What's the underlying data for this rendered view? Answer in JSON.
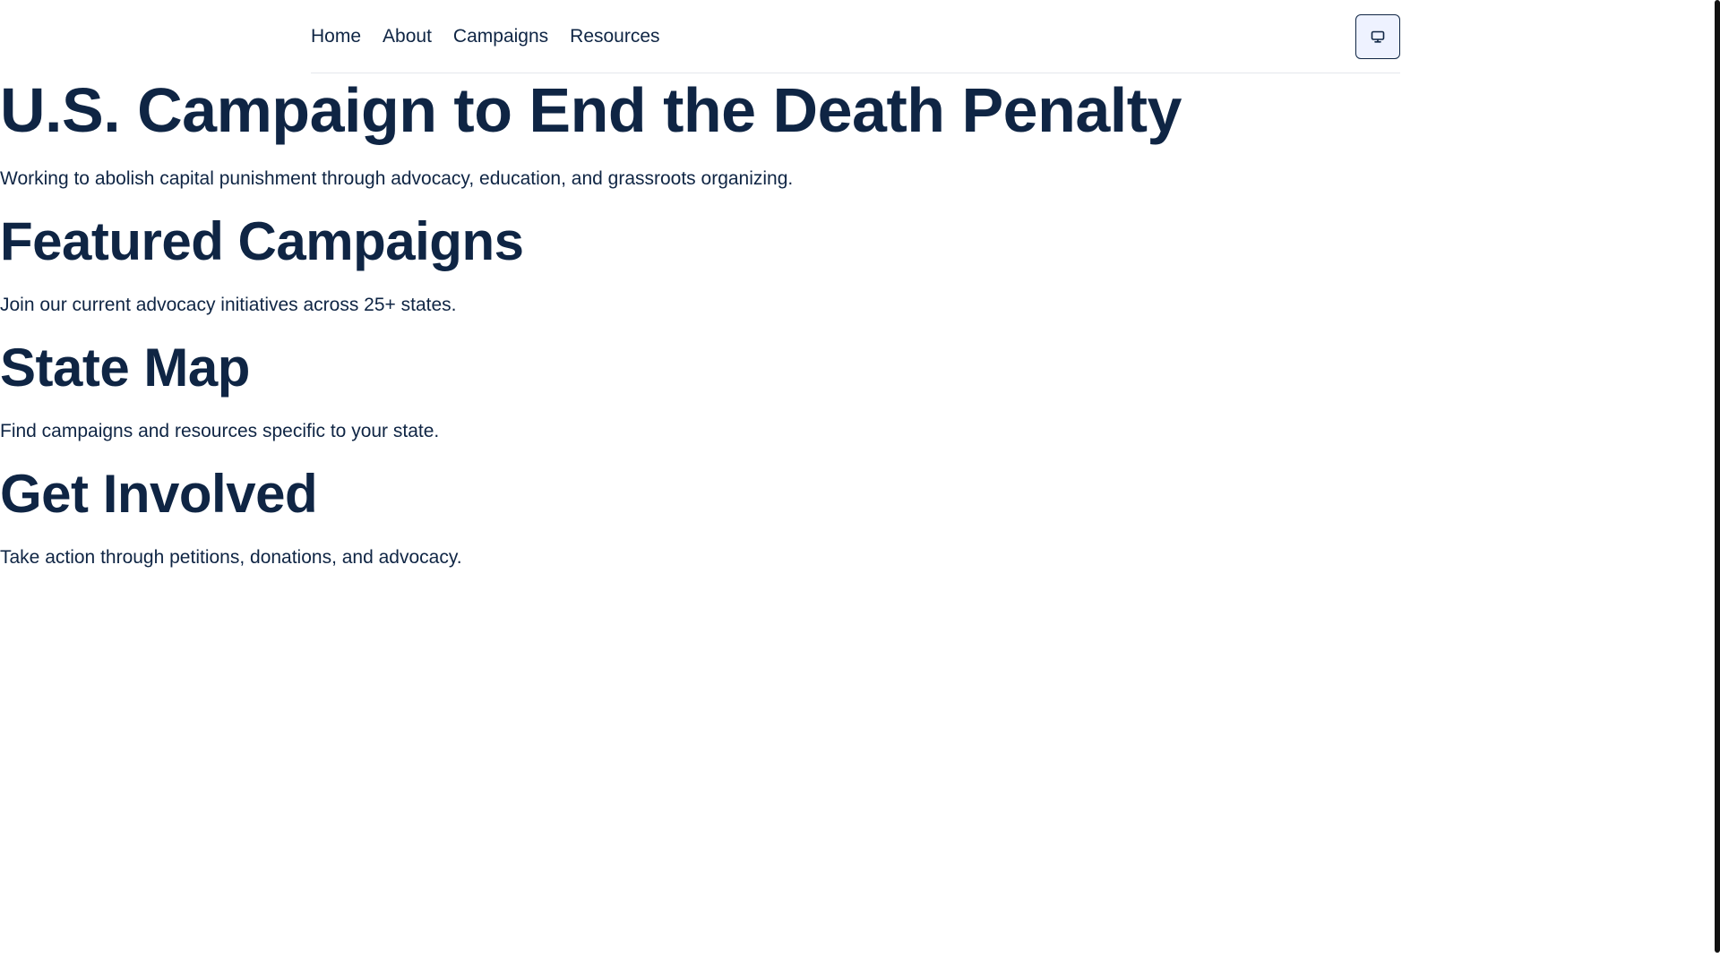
{
  "nav": {
    "links": [
      "Home",
      "About",
      "Campaigns",
      "Resources"
    ],
    "theme_toggle_icon": "monitor-icon"
  },
  "sections": [
    {
      "title": "U.S. Campaign to End the Death Penalty",
      "description": "Working to abolish capital punishment through advocacy, education, and grassroots organizing."
    },
    {
      "title": "Featured Campaigns",
      "description": "Join our current advocacy initiatives across 25+ states."
    },
    {
      "title": "State Map",
      "description": "Find campaigns and resources specific to your state."
    },
    {
      "title": "Get Involved",
      "description": "Take action through petitions, donations, and advocacy."
    }
  ],
  "colors": {
    "text": "#0f2544",
    "toggle_bg": "#eef2ff",
    "divider": "#e4e7ec"
  }
}
